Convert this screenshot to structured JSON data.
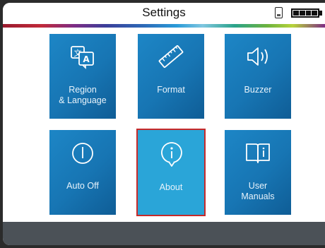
{
  "header": {
    "title": "Settings"
  },
  "status_icons": {
    "storage": "sd-card-icon",
    "battery": "battery-full-icon"
  },
  "tiles": [
    {
      "label": "Region\n& Language",
      "icon": "translate-icon"
    },
    {
      "label": "Format",
      "icon": "ruler-icon"
    },
    {
      "label": "Buzzer",
      "icon": "speaker-icon"
    },
    {
      "label": "Auto Off",
      "icon": "power-icon"
    },
    {
      "label": "About",
      "icon": "info-icon",
      "selected": true
    },
    {
      "label": "User\nManuals",
      "icon": "manual-icon"
    }
  ],
  "colors": {
    "tile": "#1775b3",
    "tile_selected": "#2aa5d8",
    "selection_border": "#c62a2a",
    "footer": "#4b5157"
  }
}
